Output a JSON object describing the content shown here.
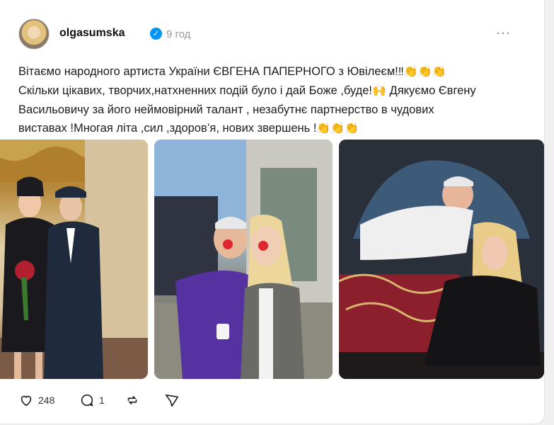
{
  "post": {
    "username": "olgasumska",
    "time": "9 год",
    "caption": {
      "line1": "Вітаємо народного артиста України ЄВГЕНА ПАПЕРНОГО з Ювілеєм!",
      "line1_emoji": "‼👏👏👏",
      "line2": "Скільки цікавих, творчих,натхненних подій було і дай Боже ,буде!",
      "line2_emoji": "🙌",
      "line2_tail": " Дякуємо Євгену",
      "line3": "Васильовичу за його неймовірний талант , незабутнє партнерство в чудових",
      "line4": "виставах !Многая літа ,сил ,здоров’я, нових звершень !",
      "line4_emoji": "👏👏👏"
    },
    "photos": [
      {
        "icon": "photo-actress-and-pilot"
      },
      {
        "icon": "photo-clown-noses"
      },
      {
        "icon": "photo-stage-scene"
      }
    ],
    "actions": {
      "likes": "248",
      "replies": "1"
    }
  }
}
